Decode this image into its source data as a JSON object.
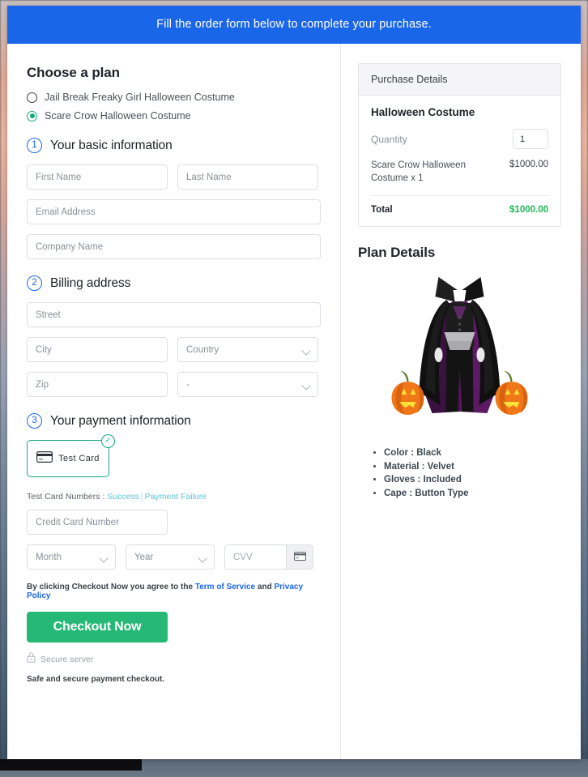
{
  "banner": {
    "text": "Fill the order form below to complete your purchase."
  },
  "plans": {
    "title": "Choose a plan",
    "options": [
      {
        "label": "Jail Break Freaky Girl Halloween Costume",
        "selected": false
      },
      {
        "label": "Scare Crow Halloween Costume",
        "selected": true
      }
    ]
  },
  "steps": {
    "basic": {
      "num": "1",
      "title": "Your basic information"
    },
    "billing": {
      "num": "2",
      "title": "Billing address"
    },
    "payment": {
      "num": "3",
      "title": "Your payment information"
    }
  },
  "basic_fields": {
    "first_name": "First Name",
    "last_name": "Last Name",
    "email": "Email Address",
    "company": "Company Name"
  },
  "billing_fields": {
    "street": "Street",
    "city": "City",
    "country": "Country",
    "zip": "Zip",
    "state": "-"
  },
  "payment": {
    "card_tile_label": "Test Card",
    "card_icon": "credit-card-icon",
    "selected_badge": "check-icon",
    "testcard_prefix": "Test Card Numbers :",
    "testcard_success": "Success",
    "testcard_separator": "|",
    "testcard_failure": "Payment Failure",
    "credit_card_number": "Credit Card Number",
    "month": "Month",
    "year": "Year",
    "cvv": "CVV",
    "cvv_icon": "credit-card-icon"
  },
  "footer": {
    "terms_prefix": "By clicking Checkout Now you agree to the",
    "terms_link": "Term of Service",
    "terms_and": "and",
    "privacy_link": "Privacy Policy",
    "checkout_label": "Checkout Now",
    "secure_icon": "lock-icon",
    "secure_text": "Secure server",
    "safe_text": "Safe and secure payment checkout."
  },
  "purchase": {
    "header": "Purchase Details",
    "product": "Halloween Costume",
    "quantity_label": "Quantity",
    "quantity_value": "1",
    "line_item": "Scare Crow Halloween Costume x 1",
    "line_price": "$1000.00",
    "total_label": "Total",
    "total_value": "$1000.00",
    "total_color": "#1db954"
  },
  "plan_details": {
    "title": "Plan Details",
    "image_alt": "black-cape-halloween-costume-with-pumpkins",
    "specs": [
      "Color : Black",
      "Material : Velvet",
      "Gloves : Included",
      "Cape : Button Type"
    ]
  },
  "colors": {
    "banner": "#1a66e8",
    "accent_green": "#16a97a",
    "checkout_green": "#26b877",
    "link_blue": "#1a66e8",
    "link_teal": "#57c5d6"
  }
}
